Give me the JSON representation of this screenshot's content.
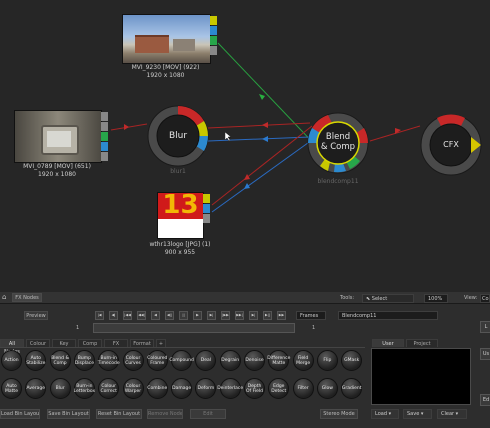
{
  "nodes": {
    "mvi9230": {
      "label": "MVI_9230 [MOV] (922)",
      "size": "1920 x 1080"
    },
    "mvi0789": {
      "label": "MVI_0789 [MOV] (651)",
      "size": "1920 x 1080"
    },
    "blur": {
      "label": "Blur",
      "sub": "blur1"
    },
    "blendcomp": {
      "label_line1": "Blend",
      "label_line2": "& Comp",
      "sub": "blendcomp11"
    },
    "cfx": {
      "label": "CFX"
    },
    "wthr13logo": {
      "label": "wthr13logo [JPG] (1)",
      "size": "900 x 955",
      "logo_text": "13"
    }
  },
  "toolbar": {
    "home_icon": "⌂",
    "fx_nodes_tab": "FX Nodes",
    "preview_button": "Preview",
    "frame_left": "1",
    "frame_right": "1",
    "frames_select": "Frames",
    "tools_label": "Tools:",
    "select_tool": "Select",
    "zoom": "100%",
    "view_label": "View:",
    "view_value": "Co",
    "node_name": "Blendcomp11",
    "transport": [
      "|◀",
      "◀|",
      "|◀◀",
      "◀◀|",
      "◀",
      "◀||",
      "||",
      "▶",
      "▶|",
      "|▶▶",
      "▶▶|",
      "▶|",
      "▶||",
      "▶▶"
    ]
  },
  "bin_tabs": [
    "All Nodes",
    "Colour",
    "Key",
    "Comp",
    "FX",
    "Format",
    "+"
  ],
  "fx_buttons": [
    "Action",
    "Auto Stabilize",
    "Blend & Comp",
    "Bump Displace",
    "Burn-in Timecode",
    "Colour Curves",
    "Coloured Frame",
    "Compound",
    "Deal",
    "Degrain",
    "Denoise",
    "Difference Matte",
    "Field Merge",
    "Flip",
    "GMask",
    "Auto Matte",
    "Average",
    "Blur",
    "Burn-in Letterbox",
    "Colour Correct",
    "Colour Warper",
    "Combine",
    "Damage",
    "Deform",
    "Deinterlace",
    "Depth Of Field",
    "Edge Detect",
    "Filter",
    "Glow",
    "Gradient"
  ],
  "bottom_buttons": [
    "Load Bin Layout",
    "Save Bin Layout",
    "Reset Bin Layout",
    "Remove Node",
    "Edit",
    "Stereo Mode"
  ],
  "user_tabs": [
    "User",
    "Project"
  ],
  "user_buttons": [
    "Load",
    "Save",
    "Clear"
  ],
  "right_edge": {
    "top": "L",
    "mid": "Us",
    "bot": "Ed"
  }
}
